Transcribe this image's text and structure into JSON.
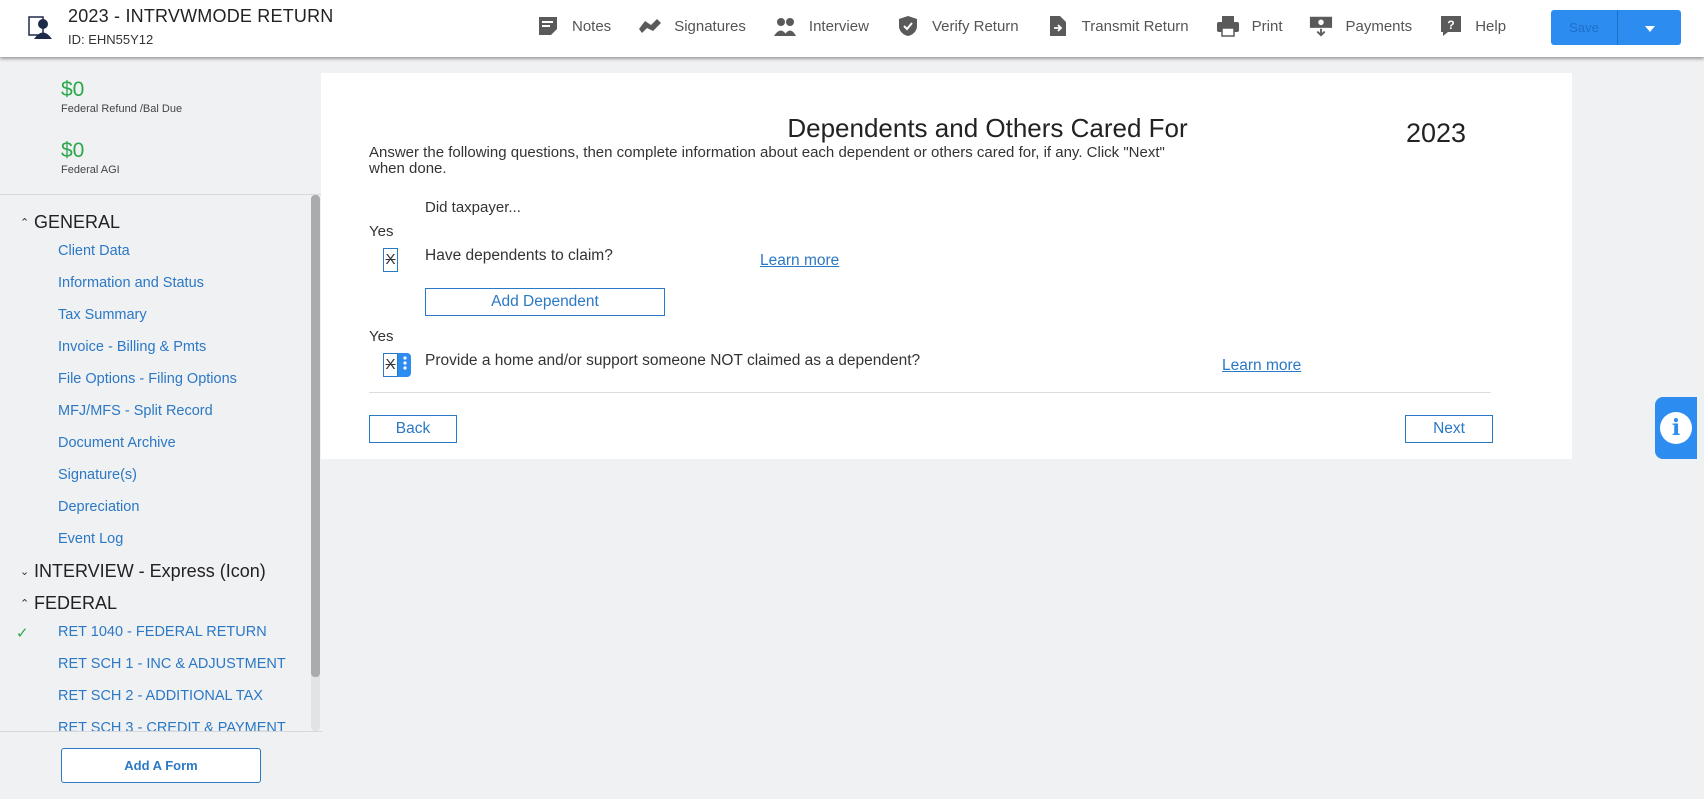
{
  "header": {
    "return_title": "2023 - INTRVWMODE RETURN",
    "return_id": "ID: EHN55Y12",
    "tools": [
      {
        "label": "Notes",
        "icon": "notes-icon"
      },
      {
        "label": "Signatures",
        "icon": "signature-icon"
      },
      {
        "label": "Interview",
        "icon": "interview-icon"
      },
      {
        "label": "Verify Return",
        "icon": "shield-check-icon"
      },
      {
        "label": "Transmit Return",
        "icon": "transmit-icon"
      },
      {
        "label": "Print",
        "icon": "printer-icon"
      },
      {
        "label": "Payments",
        "icon": "payments-icon"
      },
      {
        "label": "Help",
        "icon": "help-icon"
      }
    ],
    "save_label": "Save"
  },
  "sidebar": {
    "summary": [
      {
        "amount": "$0",
        "label": "Federal Refund /Bal Due"
      },
      {
        "amount": "$0",
        "label": "Federal AGI"
      }
    ],
    "sections": [
      {
        "title": "GENERAL",
        "state": "expanded"
      },
      {
        "title": "INTERVIEW - Express (Icon)",
        "state": "collapsed"
      },
      {
        "title": "FEDERAL",
        "state": "expanded"
      }
    ],
    "general_items": [
      "Client Data",
      "Information and Status",
      "Tax Summary",
      "Invoice - Billing & Pmts",
      "File Options - Filing Options",
      "MFJ/MFS - Split Record",
      "Document Archive",
      "Signature(s)",
      "Depreciation",
      "Event Log"
    ],
    "federal_items": [
      {
        "label": "RET 1040 - FEDERAL RETURN",
        "checked": true
      },
      {
        "label": "RET SCH 1 - INC & ADJUSTMENT",
        "checked": false
      },
      {
        "label": "RET SCH 2 - ADDITIONAL TAX",
        "checked": false
      },
      {
        "label": "RET SCH 3 - CREDIT & PAYMENT",
        "checked": false
      }
    ],
    "add_form_label": "Add A Form"
  },
  "main": {
    "title": "Dependents and Others Cared For",
    "year": "2023",
    "instructions": "Answer the following questions, then complete information about each dependent or others cared for, if any. Click \"Next\" when done.",
    "did_taxpayer": "Did taxpayer...",
    "questions": [
      {
        "yes_label": "Yes",
        "checkbox_value": "X",
        "question": "Have dependents to claim?",
        "learn_more": "Learn more"
      },
      {
        "yes_label": "Yes",
        "checkbox_value": "X",
        "question": "Provide a home and/or support someone NOT claimed as a dependent?",
        "learn_more": "Learn more"
      }
    ],
    "add_dependent_label": "Add Dependent",
    "back_label": "Back",
    "next_label": "Next"
  },
  "colors": {
    "accent": "#2d8cf0",
    "link": "#2b78c5",
    "amount_green": "#2ba84a"
  }
}
